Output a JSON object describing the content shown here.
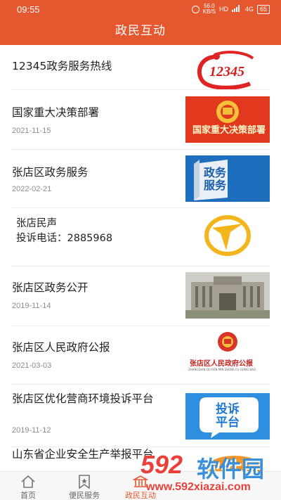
{
  "status_bar": {
    "time": "09:55",
    "speed_value": "56.0",
    "speed_unit": "KB/S",
    "network": "HD",
    "signal": "4G",
    "battery": "65"
  },
  "header": {
    "title": "政民互动"
  },
  "items": [
    {
      "title": "12345政务服务热线",
      "date": "",
      "thumb_text": "12345"
    },
    {
      "title": "国家重大决策部署",
      "date": "2021-11-15",
      "thumb_text": "国家重大决策部署"
    },
    {
      "title": "张店区政务服务",
      "date": "2022-02-21",
      "thumb_text": "政务服务"
    },
    {
      "title": "张店民声",
      "subtitle": "投诉电话：2885968",
      "date": ""
    },
    {
      "title": "张店区政务公开",
      "date": "2019-11-14"
    },
    {
      "title": "张店区人民政府公报",
      "date": "2021-03-03",
      "thumb_text": "张店区人民政府公报",
      "thumb_subtext": "ZHANGDIAN QU REN MIN ZHENG FU GONG BAO"
    },
    {
      "title": "张店区优化营商环境投诉平台",
      "date": "2019-11-12",
      "thumb_text": "投诉平台"
    },
    {
      "title": "山东省企业安全生产举报平台",
      "date": ""
    }
  ],
  "tab_bar": {
    "tabs": [
      {
        "label": "首页",
        "icon": "home-icon"
      },
      {
        "label": "便民服务",
        "icon": "bookmark-star-icon"
      },
      {
        "label": "政民互动",
        "icon": "government-building-icon"
      },
      {
        "label": "",
        "icon": ""
      },
      {
        "label": "",
        "icon": ""
      }
    ],
    "active_index": 2
  },
  "watermark": {
    "number": "592",
    "brand": "软件园",
    "url": "www.592xiazai.com"
  },
  "colors": {
    "primary": "#e4572f",
    "text": "#222222",
    "date": "#8c8c8c"
  }
}
